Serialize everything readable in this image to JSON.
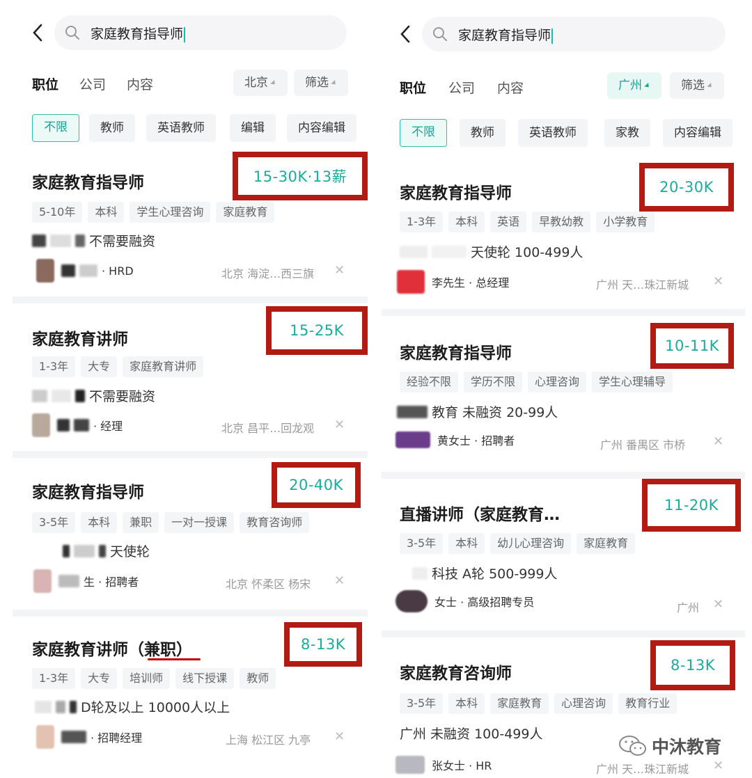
{
  "left": {
    "search": {
      "query": "家庭教育指导师"
    },
    "tabs": {
      "position": "职位",
      "company": "公司",
      "content": "内容"
    },
    "city": "北京",
    "filter": "筛选",
    "chips": [
      "不限",
      "教师",
      "英语教师",
      "编辑",
      "内容编辑"
    ],
    "jobs": [
      {
        "title": "家庭教育指导师",
        "salary": "15-30K·13薪",
        "tags": [
          "5-10年",
          "本科",
          "学生心理咨询",
          "家庭教育"
        ],
        "company": "不需要融资",
        "recruiter": "· HRD",
        "location": "北京  海淀…西三旗"
      },
      {
        "title": "家庭教育讲师",
        "salary": "15-25K",
        "tags": [
          "1-3年",
          "大专",
          "家庭教育讲师"
        ],
        "company": "不需要融资",
        "recruiter": "· 经理",
        "location": "北京  昌平…回龙观"
      },
      {
        "title": "家庭教育指导师",
        "salary": "20-40K",
        "tags": [
          "3-5年",
          "本科",
          "兼职",
          "一对一授课",
          "教育咨询师"
        ],
        "company": "天使轮",
        "recruiter": "生 · 招聘者",
        "location": "北京  怀柔区  杨宋"
      },
      {
        "title": "家庭教育讲师（兼职）",
        "salary": "8-13K",
        "tags": [
          "1-3年",
          "大专",
          "培训师",
          "线下授课",
          "教师"
        ],
        "company": "D轮及以上  10000人以上",
        "recruiter": "· 招聘经理",
        "location": "上海  松江区  九亭"
      }
    ]
  },
  "right": {
    "search": {
      "query": "家庭教育指导师"
    },
    "tabs": {
      "position": "职位",
      "company": "公司",
      "content": "内容"
    },
    "city": "广州",
    "filter": "筛选",
    "chips": [
      "不限",
      "教师",
      "英语教师",
      "家教",
      "内容编辑"
    ],
    "jobs": [
      {
        "title": "家庭教育指导师",
        "salary": "20-30K",
        "tags": [
          "1-3年",
          "本科",
          "英语",
          "早教幼教",
          "小学教育"
        ],
        "company": "天使轮  100-499人",
        "recruiter": "李先生 · 总经理",
        "location": "广州  天…珠江新城"
      },
      {
        "title": "家庭教育指导师",
        "salary": "10-11K",
        "tags": [
          "经验不限",
          "学历不限",
          "心理咨询",
          "学生心理辅导"
        ],
        "company": "教育  未融资  20-99人",
        "recruiter": "黄女士 · 招聘者",
        "location": "广州  番禺区  市桥"
      },
      {
        "title": "直播讲师（家庭教育…",
        "salary": "11-20K",
        "tags": [
          "3-5年",
          "本科",
          "幼儿心理咨询",
          "家庭教育"
        ],
        "company": "科技  A轮  500-999人",
        "recruiter": "女士 · 高级招聘专员",
        "location": "广州"
      },
      {
        "title": "家庭教育咨询师",
        "salary": "8-13K",
        "tags": [
          "3-5年",
          "本科",
          "家庭教育",
          "心理咨询",
          "教育行业"
        ],
        "company": "广州        未融资  100-499人",
        "recruiter": "张女士 · HR",
        "location": "广州  天…珠江新城"
      }
    ]
  },
  "watermark": "中沐教育",
  "colors": {
    "salary": "#1aab9b",
    "highlight_box": "#b21a14",
    "accent": "#17a394"
  }
}
